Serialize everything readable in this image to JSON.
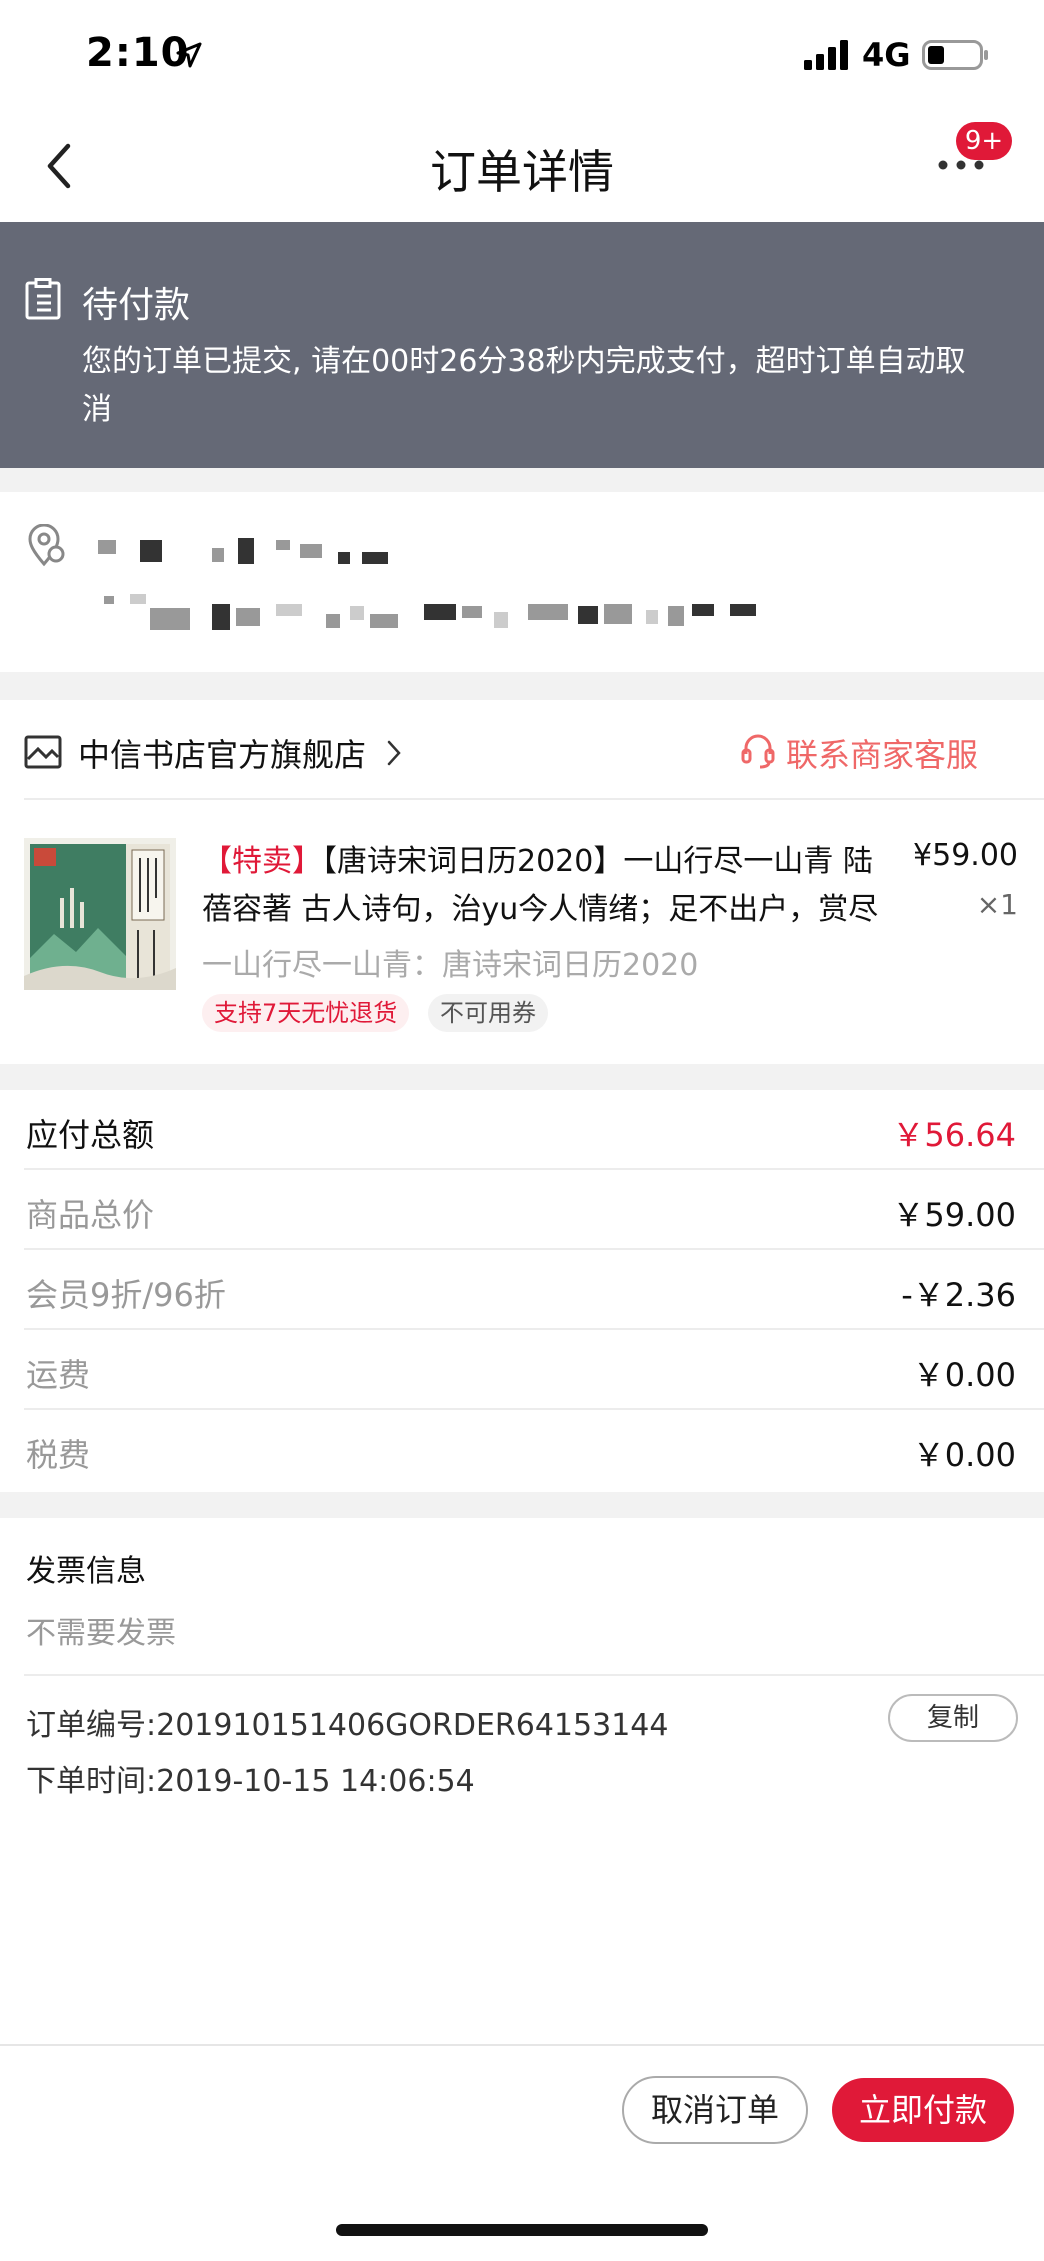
{
  "status_bar": {
    "time": "2:10",
    "network": "4G"
  },
  "nav": {
    "title": "订单详情",
    "badge": "9+"
  },
  "banner": {
    "title": "待付款",
    "message": "您的订单已提交, 请在00时26分38秒内完成支付，超时订单自动取消"
  },
  "shop": {
    "name": "中信书店官方旗舰店",
    "service_label": "联系商家客服"
  },
  "product": {
    "promo_label": "【特卖】",
    "title": "【唐诗宋词日历2020】一山行尽一山青 陆蓓容著 古人诗句，治yu今人情绪；足不出户，赏尽",
    "price": "¥59.00",
    "quantity": "×1",
    "subtitle": "一山行尽一山青：唐诗宋词日历2020",
    "tag_return": "支持7天无忧退货",
    "tag_coupon": "不可用券"
  },
  "summary": {
    "total_label": "应付总额",
    "total_value": "￥56.64",
    "goods_label": "商品总价",
    "goods_value": "￥59.00",
    "discount_label": "会员9折/96折",
    "discount_value": "-￥2.36",
    "shipping_label": "运费",
    "shipping_value": "￥0.00",
    "tax_label": "税费",
    "tax_value": "￥0.00"
  },
  "invoice": {
    "title": "发票信息",
    "value": "不需要发票"
  },
  "order": {
    "number": "订单编号:201910151406GORDER64153144",
    "time": "下单时间:2019-10-15 14:06:54",
    "copy_label": "复制"
  },
  "actions": {
    "cancel_label": "取消订单",
    "pay_label": "立即付款"
  },
  "colors": {
    "accent": "#e01938",
    "banner_bg": "#656976",
    "service_text": "#ef6868"
  },
  "icons": [
    "location-arrow-icon",
    "signal-icon",
    "battery-icon",
    "back-icon",
    "more-icon",
    "clipboard-icon",
    "location-pin-icon",
    "shop-icon",
    "chevron-right-icon",
    "headset-icon"
  ]
}
